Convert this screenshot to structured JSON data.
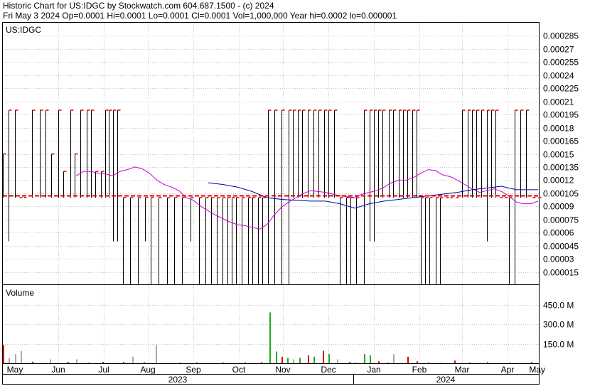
{
  "header": {
    "title": "Historic Chart for US:IDGC by Stockwatch.com 604.687.1500 - (c) 2024",
    "stats": "Fri May  3 2024  Op=0.0001  Hi=0.0001  Lo=0.0001  Cl=0.0001  Vol=1,000,000  Year hi=0.0002  lo=0.000001"
  },
  "chart_data": [
    {
      "type": "line",
      "title": "US:IDGC",
      "ylim": [
        0,
        0.0003
      ],
      "y_tick_labels": [
        "0.000285",
        "0.00027",
        "0.000255",
        "0.00024",
        "0.000225",
        "0.00021",
        "0.000195",
        "0.00018",
        "0.000165",
        "0.00015",
        "0.000135",
        "0.00012",
        "0.000105",
        "0.00009",
        "0.000075",
        "0.00006",
        "0.000045",
        "0.00003",
        "0.000015"
      ],
      "y_ticks": [
        0.000285,
        0.00027,
        0.000255,
        0.00024,
        0.000225,
        0.00021,
        0.000195,
        0.00018,
        0.000165,
        0.00015,
        0.000135,
        0.00012,
        0.000105,
        9e-05,
        7.5e-05,
        6e-05,
        4.5e-05,
        3e-05,
        1.5e-05
      ],
      "price_bars": {
        "x": [
          0,
          4,
          8,
          11,
          14,
          20,
          25,
          29,
          33,
          38,
          41,
          46,
          49,
          53,
          57,
          60,
          63,
          67,
          70,
          72,
          75,
          78,
          82,
          87,
          92,
          97,
          101,
          106,
          112,
          117,
          122,
          128,
          134,
          138,
          142,
          146,
          150,
          153,
          156,
          159,
          163,
          167,
          170,
          174,
          177,
          181,
          185,
          190,
          195,
          198,
          201,
          204,
          208,
          212,
          215,
          219,
          222,
          226,
          230,
          234,
          237,
          241,
          246,
          250,
          253,
          256,
          259,
          263,
          266,
          270,
          273,
          276,
          279,
          282,
          285,
          288,
          291,
          295,
          298,
          302,
          305,
          309,
          313,
          317,
          320,
          323,
          326,
          330,
          333,
          336,
          339,
          342,
          345,
          349,
          353,
          357,
          361,
          365
        ],
        "high": [
          0.00015,
          0.0002,
          0.0002,
          0.0001,
          0.0001,
          0.0002,
          0.0002,
          0.0002,
          0.00015,
          0.0002,
          0.00013,
          0.0002,
          0.00015,
          0.0002,
          0.0002,
          0.0002,
          0.00013,
          0.00013,
          0.0002,
          0.0002,
          0.0002,
          0.0002,
          0.0001,
          0.0001,
          0.0001,
          0.0001,
          0.0001,
          0.0001,
          0.0001,
          0.0001,
          0.0001,
          0.0001,
          0.0001,
          0.0001,
          0.0001,
          0.0001,
          0.0001,
          0.0001,
          0.0001,
          0.0001,
          0.0001,
          0.0001,
          0.0001,
          0.0001,
          0.0001,
          0.0002,
          0.0002,
          0.0002,
          0.0002,
          0.0002,
          0.0002,
          0.0002,
          0.0002,
          0.0002,
          0.0002,
          0.0002,
          0.0002,
          0.0002,
          0.0001,
          0.0001,
          0.0001,
          0.0001,
          0.0002,
          0.0002,
          0.0002,
          0.0002,
          0.0002,
          0.0002,
          0.0002,
          0.0002,
          0.0002,
          0.0002,
          0.0002,
          0.0002,
          0.0001,
          0.0001,
          0.0001,
          0.0001,
          0.0001,
          0.0001,
          0.0001,
          0.0001,
          0.0002,
          0.0002,
          0.0002,
          0.0002,
          0.0002,
          0.0002,
          0.0002,
          0.0002,
          0.0001,
          0.0001,
          0.0001,
          0.0002,
          0.0002,
          0.0002,
          0.0001,
          0.0001
        ],
        "low": [
          0.0001,
          5e-05,
          0.0001,
          0.0001,
          0.0001,
          0.0001,
          0.0001,
          0.0001,
          0.0001,
          0.0001,
          0.0001,
          0.0001,
          0.0001,
          0.0001,
          0.0001,
          0.0001,
          0.0001,
          0.0001,
          0.0001,
          0.0001,
          5e-05,
          5e-05,
          1e-06,
          1e-06,
          1e-06,
          5e-05,
          1e-06,
          1e-06,
          1e-06,
          1e-06,
          1e-06,
          5e-05,
          1e-06,
          1e-06,
          1e-06,
          1e-06,
          1e-06,
          1e-06,
          1e-06,
          1e-06,
          1e-06,
          1e-06,
          1e-06,
          1e-06,
          1e-06,
          1e-06,
          1e-06,
          1e-06,
          1e-06,
          0.0001,
          0.0001,
          0.0001,
          0.0001,
          0.0001,
          0.0001,
          0.0001,
          0.0001,
          0.0001,
          1e-06,
          1e-06,
          1e-06,
          1e-06,
          1e-06,
          5e-05,
          5e-05,
          0.0001,
          0.0001,
          0.0001,
          0.0001,
          0.0001,
          0.0001,
          0.0001,
          0.0001,
          0.0001,
          1e-06,
          1e-06,
          1e-06,
          1e-06,
          1e-06,
          0.0001,
          0.0001,
          0.0001,
          0.0001,
          0.0001,
          0.0001,
          0.0001,
          0.0001,
          5e-05,
          0.0001,
          0.0001,
          0.0001,
          0.0001,
          1e-06,
          1e-06,
          0.0001,
          0.0001,
          0.0001,
          0.0001
        ]
      },
      "series": [
        {
          "color": "#cc00cc",
          "x": [
            50,
            55,
            60,
            65,
            70,
            75,
            80,
            85,
            90,
            95,
            100,
            105,
            110,
            115,
            120,
            125,
            130,
            135,
            140,
            145,
            150,
            155,
            160,
            165,
            170,
            175,
            180,
            185,
            190,
            195,
            200,
            205,
            210,
            215,
            220,
            225,
            230,
            235,
            240,
            245,
            250,
            255,
            260,
            265,
            270,
            275,
            280,
            285,
            290,
            295,
            300,
            305,
            310,
            315,
            320,
            325,
            330,
            335,
            340,
            345,
            350,
            355,
            360,
            365
          ],
          "values": [
            0.000125,
            0.00013,
            0.00013,
            0.000128,
            0.000127,
            0.000125,
            0.00013,
            0.000132,
            0.000135,
            0.000133,
            0.000128,
            0.00012,
            0.000115,
            0.000112,
            0.000108,
            0.0001,
            9.7e-05,
            9e-05,
            8.5e-05,
            8e-05,
            7.6e-05,
            7.2e-05,
            6.9e-05,
            6.8e-05,
            6.6e-05,
            6.4e-05,
            6.9e-05,
            8e-05,
            8.9e-05,
            9.5e-05,
            0.0001,
            0.000105,
            0.000108,
            0.000107,
            0.000106,
            0.000104,
            0.000102,
            0.000101,
            0.0001,
            0.000104,
            0.000106,
            0.000108,
            0.000112,
            0.000117,
            0.00012,
            0.00012,
            0.000123,
            0.000128,
            0.000132,
            0.000131,
            0.000126,
            0.000124,
            0.00012,
            0.000115,
            0.00011,
            0.000106,
            0.000108,
            0.00011,
            0.000107,
            0.000102,
            9.5e-05,
            9.3e-05,
            9.3e-05,
            9.6e-05
          ]
        },
        {
          "color": "#0000aa",
          "x": [
            140,
            150,
            160,
            170,
            180,
            190,
            200,
            210,
            220,
            230,
            240,
            250,
            260,
            270,
            280,
            290,
            300,
            310,
            320,
            330,
            340,
            350,
            360,
            365
          ],
          "values": [
            0.000117,
            0.000115,
            0.000112,
            0.000107,
            0.0001,
            9.8e-05,
            9.7e-05,
            9.6e-05,
            9.6e-05,
            9.3e-05,
            8.8e-05,
            9.3e-05,
            9.6e-05,
            9.8e-05,
            0.0001,
            0.000102,
            0.000104,
            0.000106,
            0.000109,
            0.000111,
            0.000113,
            0.000109,
            0.000109,
            0.000109
          ]
        },
        {
          "color": "#dd0000",
          "x": [
            0,
            365
          ],
          "values": [
            0.000102,
            0.000102
          ]
        }
      ]
    },
    {
      "type": "bar",
      "title": "Volume",
      "ylim": [
        0,
        600
      ],
      "y_tick_labels": [
        "450.0 M",
        "300.0 M",
        "150.0 M"
      ],
      "y_ticks": [
        450,
        300,
        150
      ],
      "x": [
        0,
        4,
        8,
        12,
        20,
        32,
        44,
        50,
        58,
        68,
        82,
        88,
        96,
        104,
        120,
        132,
        150,
        165,
        176,
        182,
        186,
        190,
        194,
        198,
        202,
        208,
        212,
        218,
        222,
        228,
        236,
        240,
        246,
        250,
        256,
        262,
        266,
        276,
        282,
        290,
        298,
        308,
        318,
        330,
        345,
        360
      ],
      "values": [
        140,
        40,
        70,
        95,
        12,
        30,
        10,
        30,
        8,
        10,
        10,
        50,
        8,
        140,
        8,
        6,
        5,
        6,
        8,
        390,
        90,
        50,
        40,
        30,
        40,
        60,
        50,
        95,
        70,
        30,
        10,
        8,
        70,
        60,
        15,
        10,
        70,
        50,
        15,
        5,
        5,
        20,
        5,
        8,
        4,
        8
      ],
      "colors": [
        "#dd0000",
        "#aaaaaa",
        "#aaaaaa",
        "#aaaaaa",
        "#dd0000",
        "#aaaaaa",
        "#dd0000",
        "#aaaaaa",
        "#aaaaaa",
        "#dd0000",
        "#dd0000",
        "#aaaaaa",
        "#dd0000",
        "#aaaaaa",
        "#aaaaaa",
        "#dd0000",
        "#dd0000",
        "#dd0000",
        "#dd0000",
        "#22aa22",
        "#22aa22",
        "#dd0000",
        "#22aa22",
        "#aaaaaa",
        "#22aa22",
        "#dd0000",
        "#22aa22",
        "#dd0000",
        "#22aa22",
        "#aaaaaa",
        "#dd0000",
        "#aaaaaa",
        "#22aa22",
        "#22aa22",
        "#dd0000",
        "#aaaaaa",
        "#aaaaaa",
        "#dd0000",
        "#dd0000",
        "#dd0000",
        "#aaaaaa",
        "#dd0000",
        "#dd0000",
        "#dd0000",
        "#dd0000",
        "#dd0000"
      ]
    }
  ],
  "x_axis": {
    "months": [
      {
        "label": "May",
        "x": 8
      },
      {
        "label": "Jun",
        "x": 38
      },
      {
        "label": "Jul",
        "x": 69
      },
      {
        "label": "Aug",
        "x": 99
      },
      {
        "label": "Sep",
        "x": 130
      },
      {
        "label": "Oct",
        "x": 161
      },
      {
        "label": "Nov",
        "x": 191
      },
      {
        "label": "Dec",
        "x": 222
      },
      {
        "label": "Jan",
        "x": 253
      },
      {
        "label": "Feb",
        "x": 284
      },
      {
        "label": "Mar",
        "x": 313
      },
      {
        "label": "Apr",
        "x": 344
      },
      {
        "label": "May",
        "x": 365
      }
    ],
    "years": [
      {
        "label": "2023"
      },
      {
        "label": "2024"
      }
    ]
  }
}
